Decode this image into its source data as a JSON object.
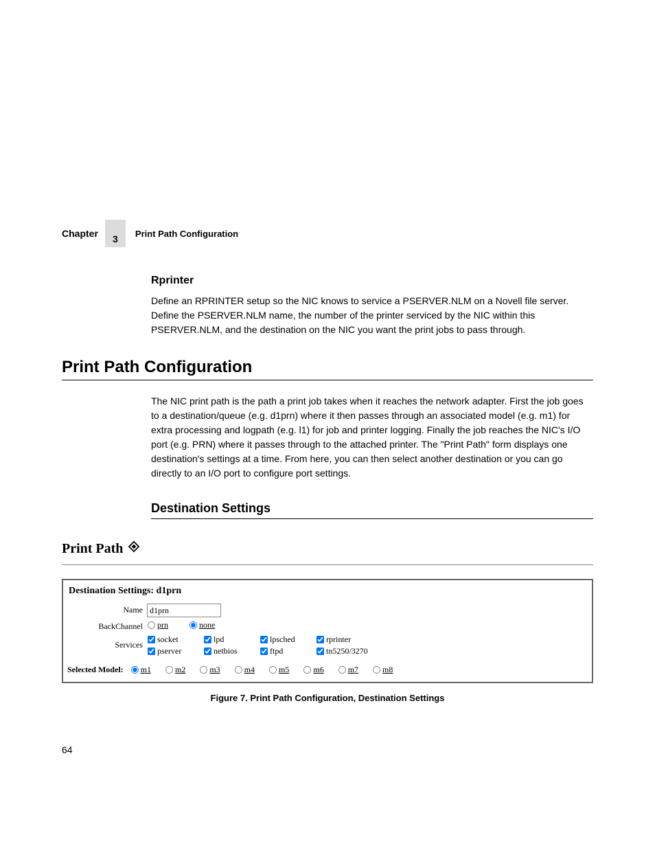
{
  "header": {
    "chapter_label": "Chapter",
    "chapter_number": "3",
    "title": "Print Path Configuration"
  },
  "section_rprinter": {
    "heading": "Rprinter",
    "body": "Define an RPRINTER setup so the NIC knows to service a PSERVER.NLM on a Novell file server. Define the PSERVER.NLM name, the number of the printer serviced by the NIC within this PSERVER.NLM, and the destination on the NIC you want the print jobs to pass through."
  },
  "section_main": {
    "heading": "Print Path Configuration",
    "body": "The NIC print path is the path a print job takes when it reaches the network adapter. First the job goes to a destination/queue (e.g. d1prn) where it then passes through an associated model (e.g. m1) for extra processing and logpath (e.g. l1) for job and printer logging. Finally the job reaches the NIC's I/O port (e.g. PRN) where it passes through to the attached printer. The \"Print Path\" form displays one destination's settings at a time. From here, you can then select another destination or you can go directly to an I/O port to configure port settings."
  },
  "section_dest": {
    "heading": "Destination Settings"
  },
  "figure": {
    "title": "Print Path",
    "box_title": "Destination Settings: d1prn",
    "labels": {
      "name": "Name",
      "backchannel": "BackChannel",
      "services": "Services",
      "selected_model": "Selected Model:"
    },
    "name_value": "d1prn",
    "backchannel": [
      {
        "label": "prn",
        "checked": false
      },
      {
        "label": "none",
        "checked": true
      }
    ],
    "services": [
      {
        "label": "socket",
        "checked": true
      },
      {
        "label": "lpd",
        "checked": true
      },
      {
        "label": "lpsched",
        "checked": true
      },
      {
        "label": "rprinter",
        "checked": true
      },
      {
        "label": "pserver",
        "checked": true
      },
      {
        "label": "netbios",
        "checked": true
      },
      {
        "label": "ftpd",
        "checked": true
      },
      {
        "label": "tn5250/3270",
        "checked": true
      }
    ],
    "models": [
      {
        "label": "m1",
        "checked": true
      },
      {
        "label": "m2",
        "checked": false
      },
      {
        "label": "m3",
        "checked": false
      },
      {
        "label": "m4",
        "checked": false
      },
      {
        "label": "m5",
        "checked": false
      },
      {
        "label": "m6",
        "checked": false
      },
      {
        "label": "m7",
        "checked": false
      },
      {
        "label": "m8",
        "checked": false
      }
    ],
    "caption": "Figure 7. Print Path Configuration, Destination Settings"
  },
  "page_number": "64"
}
